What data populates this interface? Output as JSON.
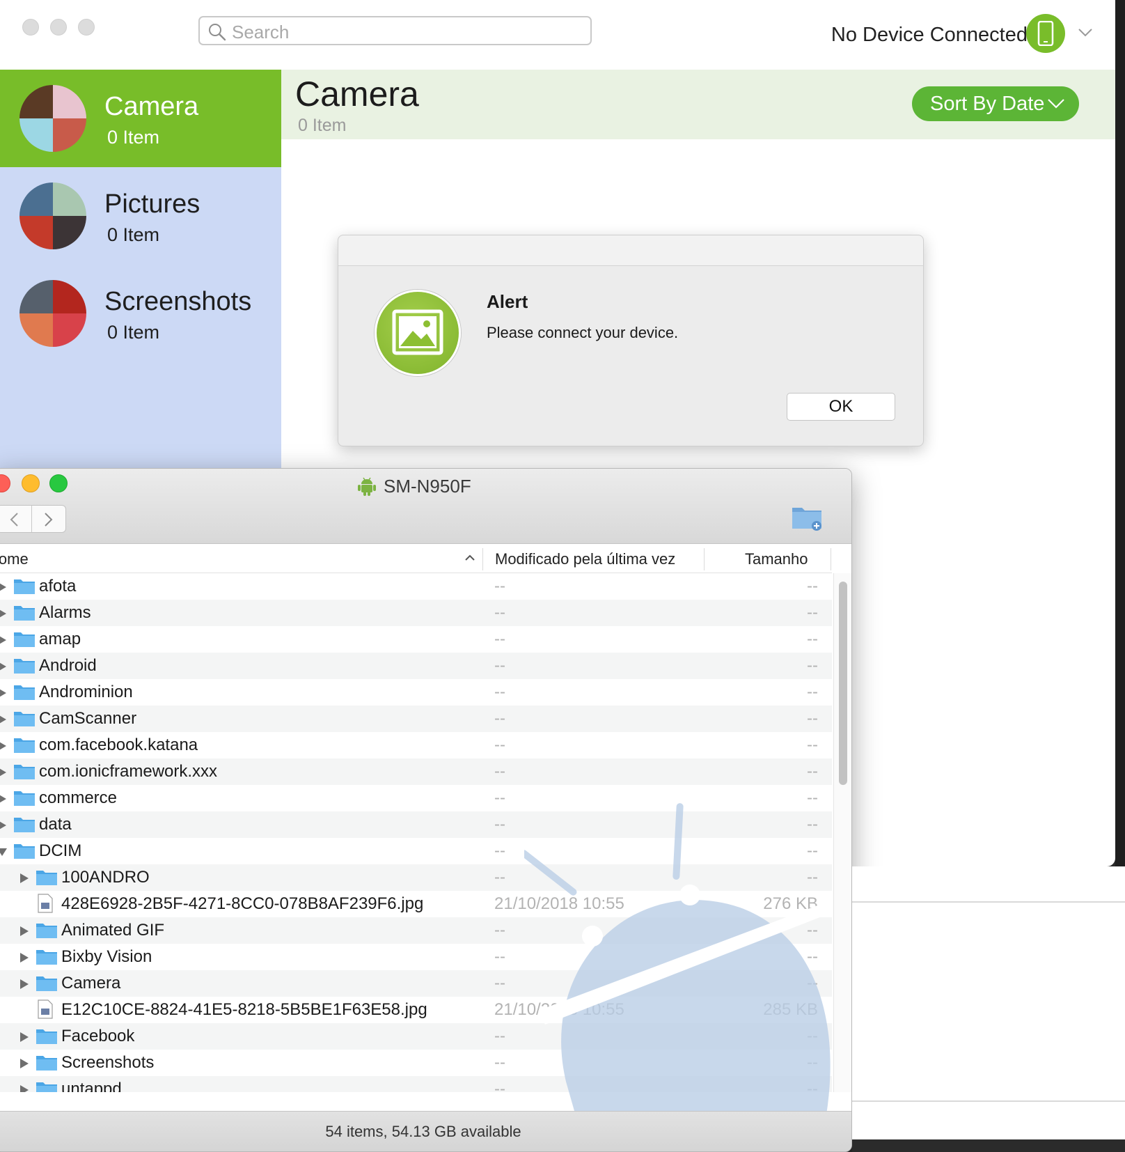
{
  "app": {
    "search_placeholder": "Search",
    "device_status": "No Device Connected",
    "albums": [
      {
        "name": "Camera",
        "count": "0 Item",
        "active": true
      },
      {
        "name": "Pictures",
        "count": "0 Item",
        "active": false
      },
      {
        "name": "Screenshots",
        "count": "0 Item",
        "active": false
      }
    ],
    "content": {
      "title": "Camera",
      "count": "0 Item"
    },
    "sort_label": "Sort By Date",
    "accent_color": "#78bd29"
  },
  "alert": {
    "title": "Alert",
    "message": "Please connect your device.",
    "ok_label": "OK"
  },
  "finder": {
    "title": "SM-N950F",
    "columns": {
      "name": "lome",
      "modified": "Modificado pela última vez",
      "size": "Tamanho"
    },
    "rows": [
      {
        "name": "afota",
        "type": "folder",
        "level": 0,
        "expanded": false,
        "date": "--",
        "size": "--"
      },
      {
        "name": "Alarms",
        "type": "folder",
        "level": 0,
        "expanded": false,
        "date": "--",
        "size": "--"
      },
      {
        "name": "amap",
        "type": "folder",
        "level": 0,
        "expanded": false,
        "date": "--",
        "size": "--"
      },
      {
        "name": "Android",
        "type": "folder",
        "level": 0,
        "expanded": false,
        "date": "--",
        "size": "--"
      },
      {
        "name": "Androminion",
        "type": "folder",
        "level": 0,
        "expanded": false,
        "date": "--",
        "size": "--"
      },
      {
        "name": "CamScanner",
        "type": "folder",
        "level": 0,
        "expanded": false,
        "date": "--",
        "size": "--"
      },
      {
        "name": "com.facebook.katana",
        "type": "folder",
        "level": 0,
        "expanded": false,
        "date": "--",
        "size": "--"
      },
      {
        "name": "com.ionicframework.xxx",
        "type": "folder",
        "level": 0,
        "expanded": false,
        "date": "--",
        "size": "--"
      },
      {
        "name": "commerce",
        "type": "folder",
        "level": 0,
        "expanded": false,
        "date": "--",
        "size": "--"
      },
      {
        "name": "data",
        "type": "folder",
        "level": 0,
        "expanded": false,
        "date": "--",
        "size": "--"
      },
      {
        "name": "DCIM",
        "type": "folder",
        "level": 0,
        "expanded": true,
        "date": "--",
        "size": "--"
      },
      {
        "name": "100ANDRO",
        "type": "folder",
        "level": 1,
        "expanded": false,
        "date": "--",
        "size": "--"
      },
      {
        "name": "428E6928-2B5F-4271-8CC0-078B8AF239F6.jpg",
        "type": "file",
        "level": 1,
        "expanded": false,
        "date": "21/10/2018 10:55",
        "size": "276 KB"
      },
      {
        "name": "Animated GIF",
        "type": "folder",
        "level": 1,
        "expanded": false,
        "date": "--",
        "size": "--"
      },
      {
        "name": "Bixby Vision",
        "type": "folder",
        "level": 1,
        "expanded": false,
        "date": "--",
        "size": "--"
      },
      {
        "name": "Camera",
        "type": "folder",
        "level": 1,
        "expanded": false,
        "date": "--",
        "size": "--"
      },
      {
        "name": "E12C10CE-8824-41E5-8218-5B5BE1F63E58.jpg",
        "type": "file",
        "level": 1,
        "expanded": false,
        "date": "21/10/2018 10:55",
        "size": "285 KB"
      },
      {
        "name": "Facebook",
        "type": "folder",
        "level": 1,
        "expanded": false,
        "date": "--",
        "size": "--"
      },
      {
        "name": "Screenshots",
        "type": "folder",
        "level": 1,
        "expanded": false,
        "date": "--",
        "size": "--"
      },
      {
        "name": "untappd",
        "type": "folder",
        "level": 1,
        "expanded": false,
        "date": "--",
        "size": "--"
      }
    ],
    "status": "54 items, 54.13 GB available"
  }
}
